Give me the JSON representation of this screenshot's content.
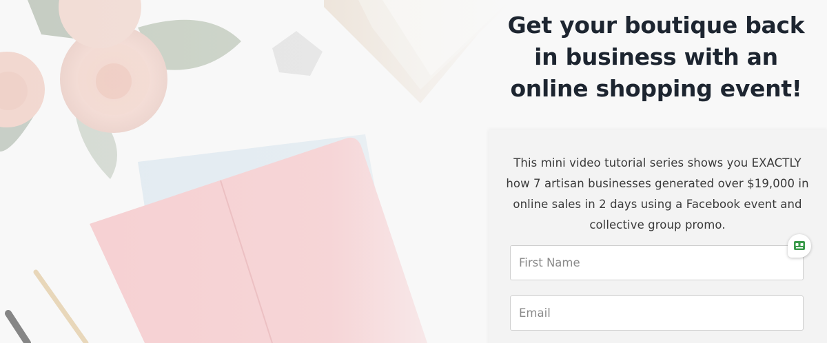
{
  "hero": {
    "headline": "Get your boutique back in business with an online shopping event!"
  },
  "optin": {
    "description": "This mini video tutorial series shows you EXACTLY how 7 artisan businesses generated over $19,000 in online sales in 2 days using a Facebook event and collective group promo.",
    "first_name_placeholder": "First Name",
    "email_placeholder": "Email"
  },
  "icons": {
    "chat_widget": "robot-chat-icon"
  },
  "colors": {
    "headline": "#1d2530",
    "card_bg": "#f3f3f3",
    "widget_accent": "#3a9a4a"
  }
}
